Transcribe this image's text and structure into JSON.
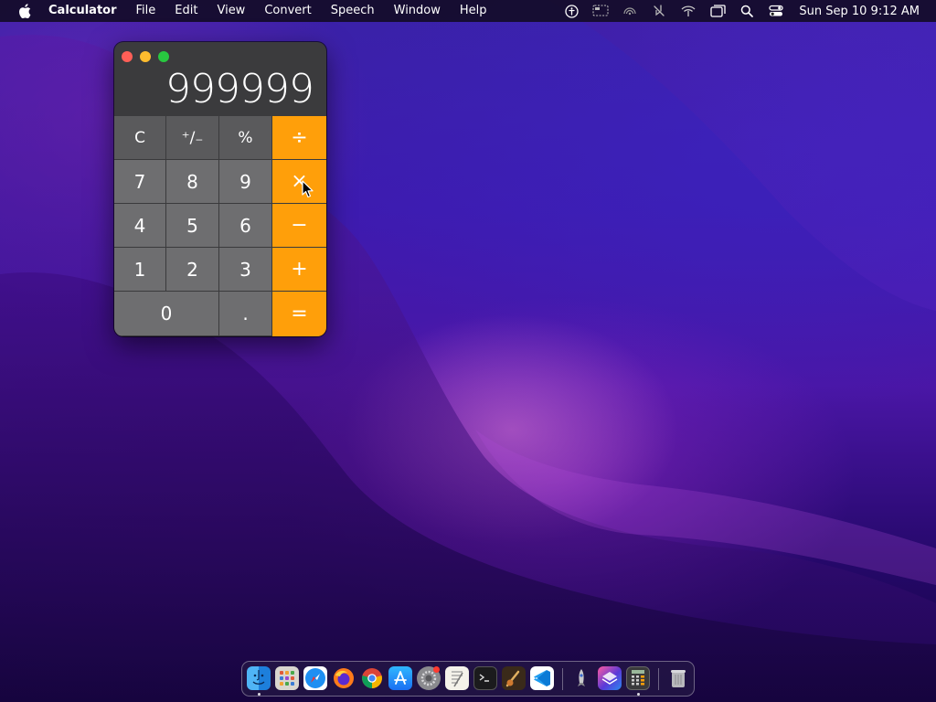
{
  "menubar": {
    "apple_icon": "apple-logo-icon",
    "items": [
      "Calculator",
      "File",
      "Edit",
      "View",
      "Convert",
      "Speech",
      "Window",
      "Help"
    ],
    "status_icons": [
      "accessibility-icon",
      "screen-mirroring-icon",
      "airdrop-icon",
      "mute-icon",
      "wifi-icon",
      "window-icon",
      "search-icon",
      "control-center-icon"
    ],
    "clock": "Sun Sep 10  9:12 AM"
  },
  "calculator": {
    "display_value": "999999",
    "keys": {
      "clear": "C",
      "sign": "⁺∕₋",
      "percent": "%",
      "divide": "÷",
      "seven": "7",
      "eight": "8",
      "nine": "9",
      "multiply": "×",
      "four": "4",
      "five": "5",
      "six": "6",
      "minus": "−",
      "one": "1",
      "two": "2",
      "three": "3",
      "plus": "+",
      "zero": "0",
      "decimal": ".",
      "equals": "="
    },
    "colors": {
      "operator": "#ff9f0a",
      "number": "#6e6e70",
      "function": "#5a5a5c"
    }
  },
  "dock": {
    "apps": [
      "finder-icon",
      "launchpad-icon",
      "safari-icon",
      "firefox-icon",
      "chrome-icon",
      "app-store-icon",
      "system-settings-icon",
      "textedit-icon",
      "terminal-icon",
      "instruments-icon",
      "vscode-icon",
      "rocket-icon",
      "layers-app-icon",
      "calculator-icon",
      "trash-icon"
    ]
  }
}
